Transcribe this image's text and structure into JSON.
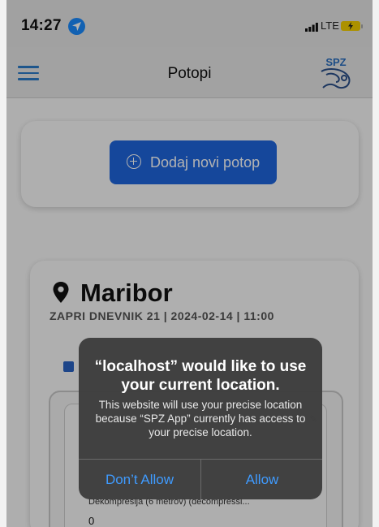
{
  "status_bar": {
    "time": "14:27",
    "network": "LTE"
  },
  "header": {
    "title": "Potopi",
    "logo_text": "SPZ"
  },
  "add_card": {
    "button_label": "Dodaj novi potop"
  },
  "dive_card": {
    "city": "Maribor",
    "meta": "ZAPRI DNEVNIK 21 | 2024-02-14 | 11:00",
    "decompression_label": "Dekompresija (6 metrov) (decompressi...",
    "decompression_value": "0"
  },
  "dialog": {
    "title": "“localhost” would like to use your current location.",
    "message": "This website will use your precise location because “SPZ App” currently has access to your precise location.",
    "deny_label": "Don’t Allow",
    "allow_label": "Allow"
  },
  "colors": {
    "accent": "#1f66de",
    "dialog_button": "#3f9bff",
    "location_badge": "#1a8cff",
    "battery": "#f6d000"
  },
  "icons": [
    "location-arrow-icon",
    "signal-icon",
    "battery-charging-icon",
    "hamburger-menu-icon",
    "plus-circle-icon",
    "map-pin-icon",
    "checkbox-icon"
  ]
}
